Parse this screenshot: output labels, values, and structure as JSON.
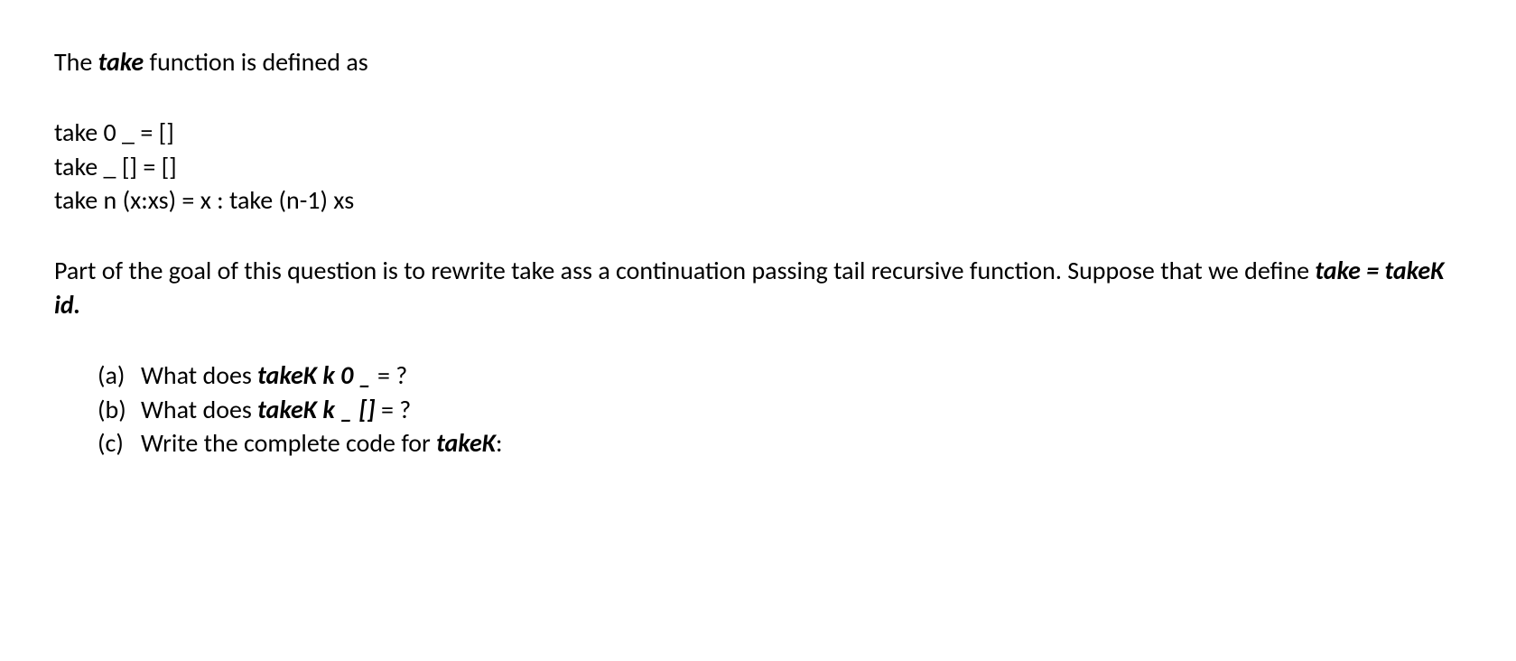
{
  "intro": {
    "pre": "The ",
    "fn": "take",
    "post": " function is defined as"
  },
  "code": {
    "l1": "take 0  _  = []",
    "l2": "take  _  [] = []",
    "l3": "take n (x:xs) = x : take (n-1) xs"
  },
  "goal": {
    "p1": "Part of the goal of this question is to rewrite take ass a continuation passing tail recursive function. Suppose that we define ",
    "def": "take = takeK id."
  },
  "questions": {
    "a": {
      "marker": "(a)",
      "pre": "What does ",
      "code": "takeK k 0  _ ",
      "post": " = ?"
    },
    "b": {
      "marker": "(b)",
      "pre": "What does ",
      "code": "takeK k _  []",
      "post": " = ?"
    },
    "c": {
      "marker": "(c)",
      "pre": "Write the complete code for ",
      "code": "takeK",
      "post": ":"
    }
  }
}
